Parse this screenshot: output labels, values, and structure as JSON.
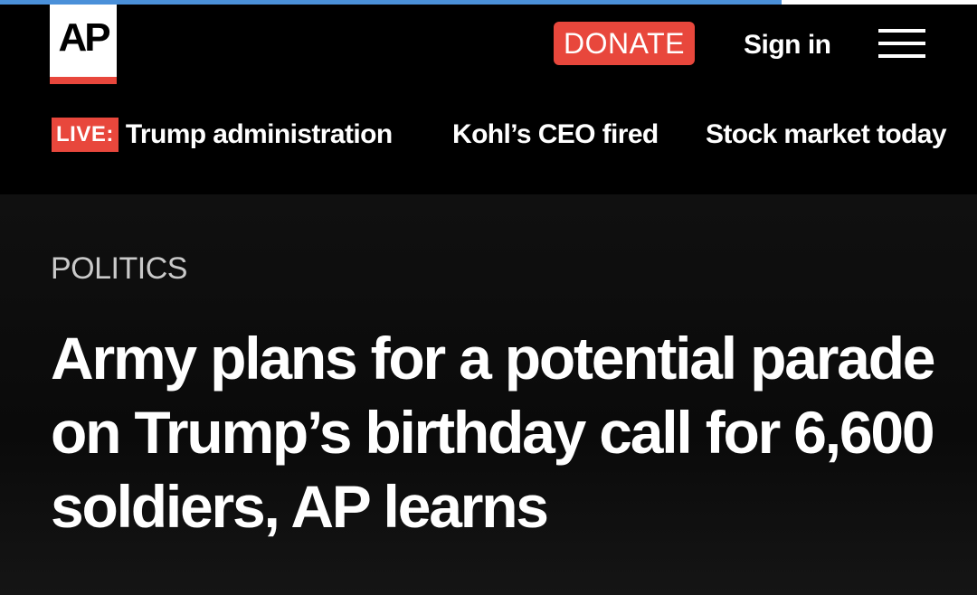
{
  "progress": {
    "fraction": 0.8,
    "fill_color": "#4a90d9"
  },
  "header": {
    "logo_text": "AP",
    "donate_label": "DONATE",
    "signin_label": "Sign in",
    "menu_icon": "hamburger-menu-icon",
    "accent_color": "#e8473c"
  },
  "trending": {
    "live_badge": "LIVE:",
    "items": [
      {
        "label": "Trump administration"
      },
      {
        "label": "Kohl’s CEO fired"
      },
      {
        "label": "Stock market today"
      }
    ]
  },
  "article": {
    "category": "POLITICS",
    "headline": "Army plans for a potential parade on Trump’s birthday call for 6,600 soldiers, AP learns"
  }
}
